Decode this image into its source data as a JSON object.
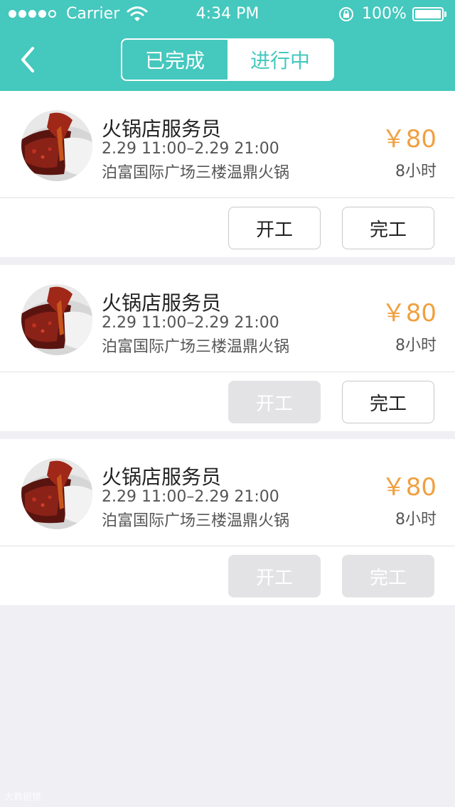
{
  "status_bar": {
    "carrier": "Carrier",
    "time": "4:34 PM",
    "battery": "100%"
  },
  "nav": {
    "back_icon": "chevron-left-icon",
    "tabs": [
      {
        "label": "已完成",
        "active": false
      },
      {
        "label": "进行中",
        "active": true
      }
    ]
  },
  "jobs": [
    {
      "title": "火锅店服务员",
      "time": "2.29 11:00–2.29 21:00",
      "address": "泊富国际广场三楼温鼎火锅",
      "price": "￥80",
      "duration": "8小时",
      "start_label": "开工",
      "start_enabled": true,
      "finish_label": "完工",
      "finish_enabled": true
    },
    {
      "title": "火锅店服务员",
      "time": "2.29 11:00–2.29 21:00",
      "address": "泊富国际广场三楼温鼎火锅",
      "price": "￥80",
      "duration": "8小时",
      "start_label": "开工",
      "start_enabled": false,
      "finish_label": "完工",
      "finish_enabled": true
    },
    {
      "title": "火锅店服务员",
      "time": "2.29 11:00–2.29 21:00",
      "address": "泊富国际广场三楼温鼎火锅",
      "price": "￥80",
      "duration": "8小时",
      "start_label": "开工",
      "start_enabled": false,
      "finish_label": "完工",
      "finish_enabled": false
    }
  ],
  "watermark": "大数据猎"
}
